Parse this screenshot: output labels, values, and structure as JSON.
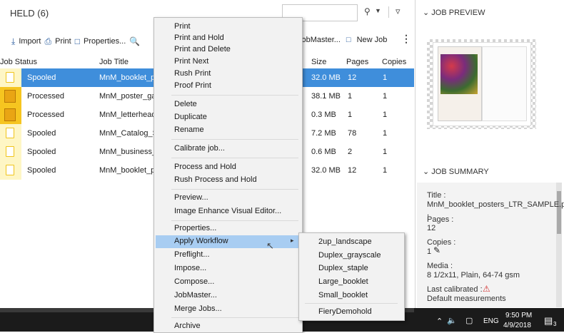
{
  "header": {
    "title": "HELD (6)",
    "search_placeholder": ""
  },
  "toolbar": {
    "import": "Import",
    "print": "Print",
    "properties": "Properties...",
    "jobmaster": "JobMaster...",
    "new_job": "New Job"
  },
  "columns": {
    "status": "Job Status",
    "title": "Job Title",
    "size": "Size",
    "pages": "Pages",
    "copies": "Copies"
  },
  "jobs": [
    {
      "status": "Spooled",
      "title": "MnM_booklet_po",
      "size": "32.0 MB",
      "pages": "12",
      "copies": "1"
    },
    {
      "status": "Processed",
      "title": "MnM_poster_gard",
      "size": "38.1 MB",
      "pages": "1",
      "copies": "1"
    },
    {
      "status": "Processed",
      "title": "MnM_letterhead_",
      "size": "0.3 MB",
      "pages": "1",
      "copies": "1"
    },
    {
      "status": "Spooled",
      "title": "MnM_Catalog_SA",
      "size": "7.2 MB",
      "pages": "78",
      "copies": "1"
    },
    {
      "status": "Spooled",
      "title": "MnM_business_ca",
      "size": "0.6 MB",
      "pages": "2",
      "copies": "1"
    },
    {
      "status": "Spooled",
      "title": "MnM_booklet_po",
      "size": "32.0 MB",
      "pages": "12",
      "copies": "1"
    }
  ],
  "context_menu": {
    "items": [
      "Print",
      "Print and Hold",
      "Print and Delete",
      "Print Next",
      "Rush Print",
      "Proof Print",
      "Delete",
      "Duplicate",
      "Rename",
      "Calibrate job...",
      "Process and Hold",
      "Rush Process and Hold",
      "Preview...",
      "Image Enhance Visual Editor...",
      "Properties...",
      "Apply Workflow",
      "Preflight...",
      "Impose...",
      "Compose...",
      "JobMaster...",
      "Merge Jobs...",
      "Archive"
    ],
    "highlighted": "Apply Workflow"
  },
  "submenu": {
    "items": [
      "2up_landscape",
      "Duplex_grayscale",
      "Duplex_staple",
      "Large_booklet",
      "Small_booklet",
      "FieryDemohold"
    ]
  },
  "preview": {
    "title": "JOB PREVIEW"
  },
  "summary": {
    "title": "JOB SUMMARY",
    "title_label": "Title :",
    "title_value": "MnM_booklet_posters_LTR_SAMPLE.pdf ,",
    "pages_label": "Pages :",
    "pages_value": "12",
    "copies_label": "Copies :",
    "copies_value": "1",
    "media_label": "Media :",
    "media_value": "8 1/2x11, Plain, 64-74 gsm",
    "calibrated_label": "Last calibrated :",
    "calibrated_value": "Default measurements"
  },
  "taskbar": {
    "lang": "ENG",
    "time": "9:50 PM",
    "date": "4/9/2018",
    "notifications": "3"
  },
  "colors": {
    "selection": "#3f8edb",
    "menu_highlight": "#a8cdf2",
    "spooled_strip": "#fef6c5",
    "processed_strip": "#f6c520"
  }
}
